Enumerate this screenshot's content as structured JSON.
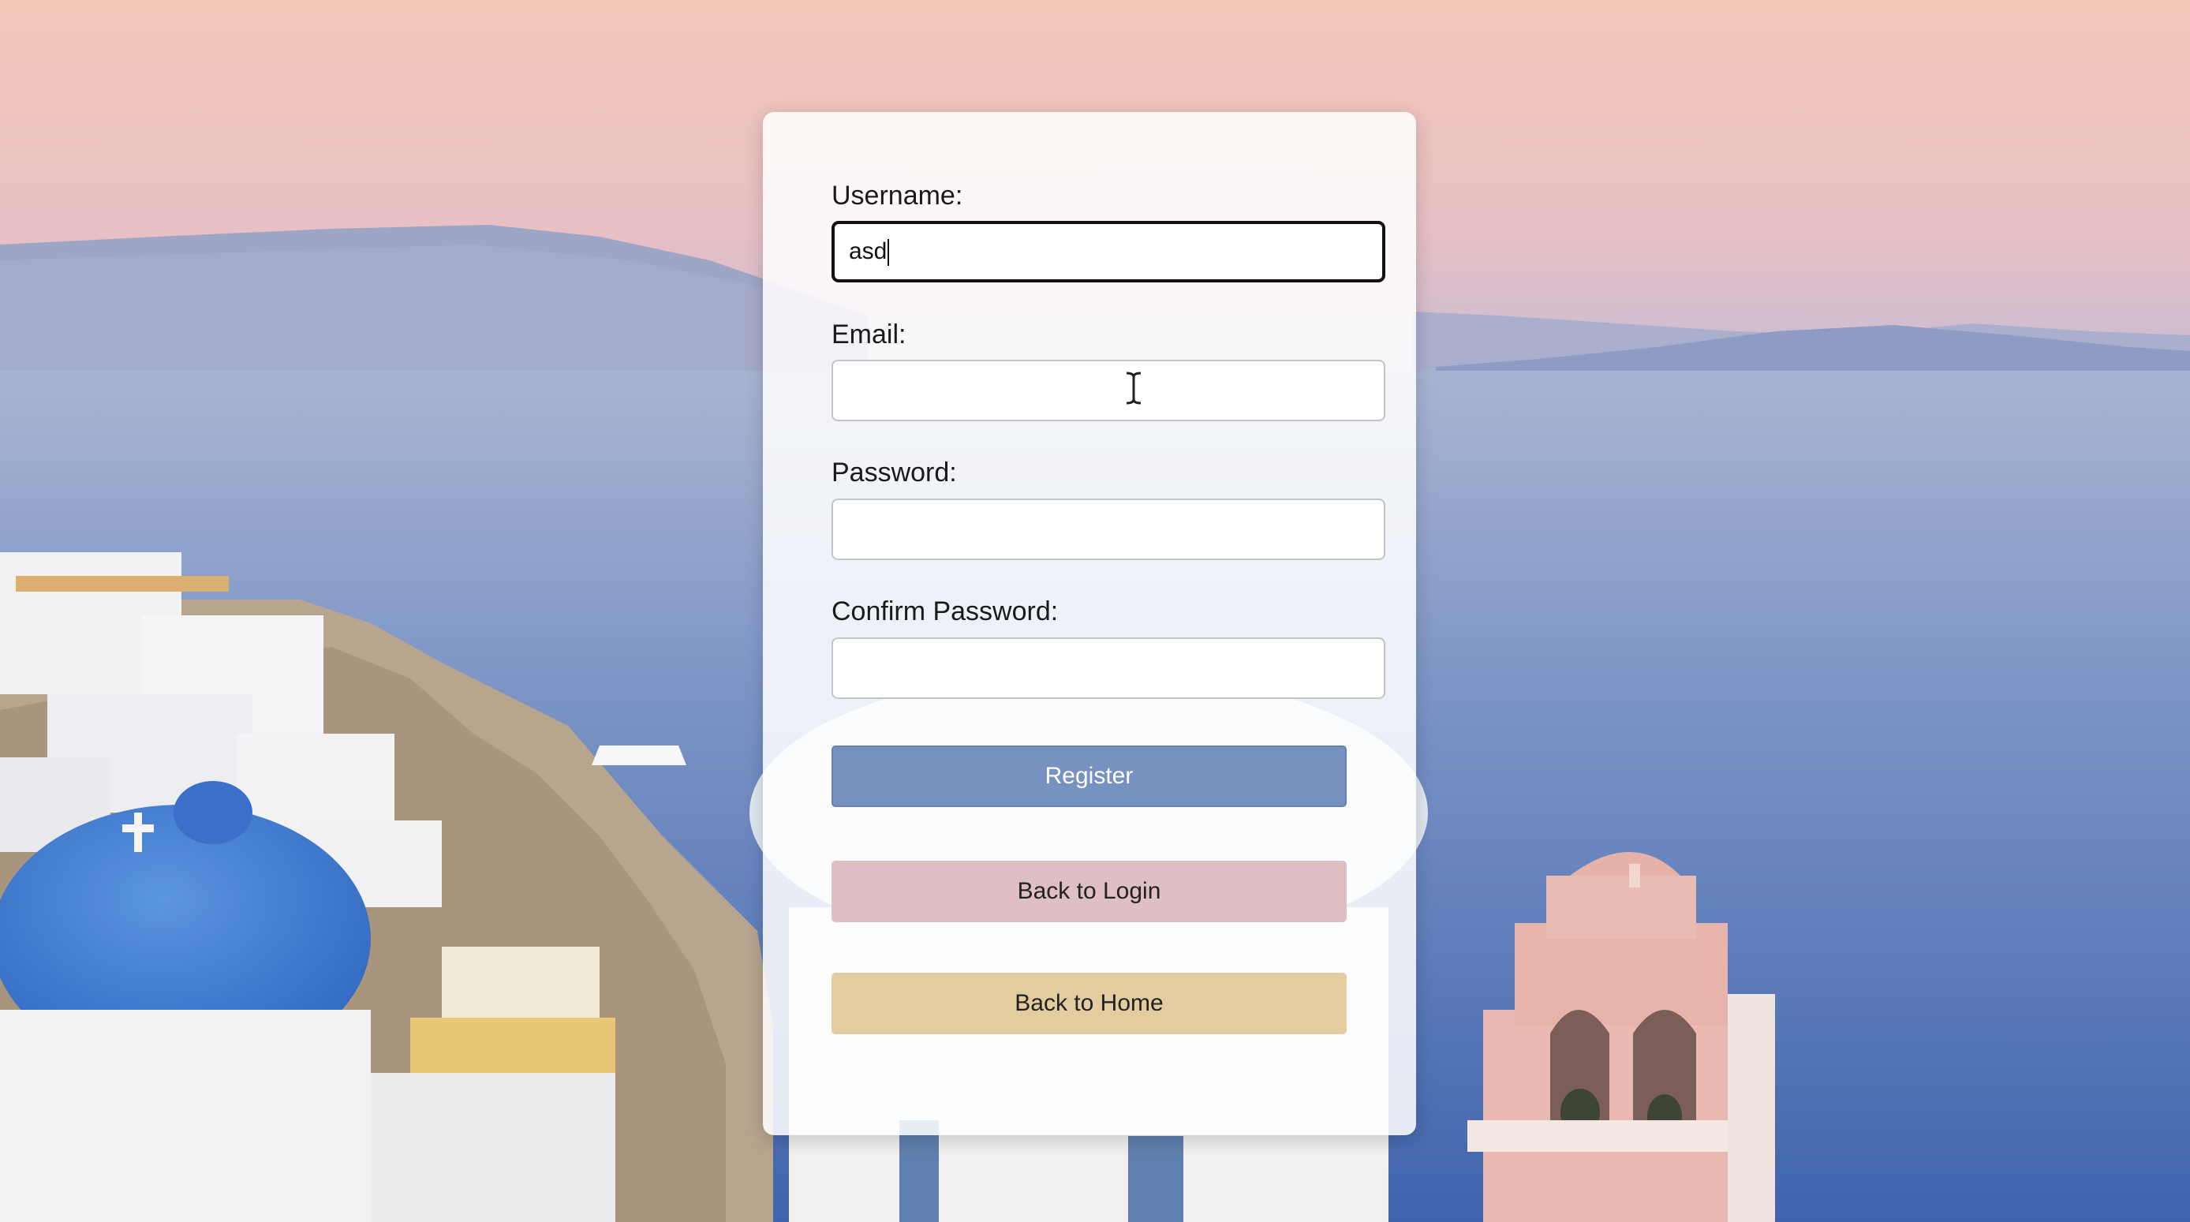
{
  "form": {
    "username": {
      "label": "Username:",
      "value": "asd"
    },
    "email": {
      "label": "Email:",
      "value": ""
    },
    "password": {
      "label": "Password:",
      "value": ""
    },
    "confirm_password": {
      "label": "Confirm Password:",
      "value": ""
    }
  },
  "buttons": {
    "register": "Register",
    "back_to_login": "Back to Login",
    "back_to_home": "Back to Home"
  },
  "colors": {
    "register": "#7791c0",
    "back_to_login": "#dfbfc3",
    "back_to_home": "#e3cc9f",
    "sky_top": "#f2c6b8",
    "sea": "#5a7ab8"
  },
  "icons": {
    "cursor": "text-ibeam-cursor-icon"
  }
}
